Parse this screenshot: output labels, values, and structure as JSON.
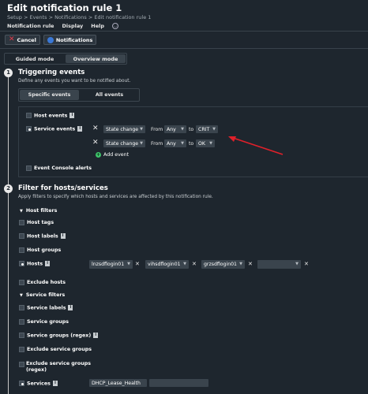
{
  "header": {
    "title": "Edit notification rule 1",
    "breadcrumb": "Setup > Events > Notifications > Edit notification rule 1"
  },
  "menu": {
    "items": [
      "Notification rule",
      "Display",
      "Help"
    ],
    "help_icon": "help-circle-icon"
  },
  "actions": {
    "cancel_label": "Cancel",
    "notifications_label": "Notifications"
  },
  "modes": {
    "guided": "Guided mode",
    "overview": "Overview mode",
    "selected": "Overview mode"
  },
  "step1": {
    "number": "1",
    "title": "Triggering events",
    "description": "Define any events you want to be notified about.",
    "tabs": [
      "Specific events",
      "All events"
    ],
    "selected_tab": "Specific events",
    "host_events": {
      "label": "Host events",
      "checked": false
    },
    "service_events": {
      "label": "Service events",
      "checked": true
    },
    "rules": [
      {
        "type": "State change",
        "from_label": "From",
        "from": "Any",
        "to_label": "to",
        "to": "CRIT"
      },
      {
        "type": "State change",
        "from_label": "From",
        "from": "Any",
        "to_label": "to",
        "to": "OK"
      }
    ],
    "add_event": "Add event",
    "event_console": {
      "label": "Event Console alerts",
      "checked": false
    }
  },
  "step2": {
    "number": "2",
    "title": "Filter for hosts/services",
    "description": "Apply filters to specify which hosts and services are affected by this notification rule.",
    "host_filters_label": "Host filters",
    "host_tags": "Host tags",
    "host_labels": "Host labels",
    "host_groups": "Host groups",
    "hosts": {
      "label": "Hosts",
      "checked": true,
      "values": [
        "lnzsdflogin01",
        "vihsdflogin01",
        "grzsdflogin01",
        ""
      ]
    },
    "exclude_hosts": "Exclude hosts",
    "service_filters_label": "Service filters",
    "service_labels": "Service labels",
    "service_groups": "Service groups",
    "service_groups_regex": "Service groups (regex)",
    "exclude_service_groups": "Exclude service groups",
    "exclude_service_groups_regex_1": "Exclude service groups",
    "exclude_service_groups_regex_2": "(regex)",
    "services": {
      "label": "Services",
      "checked": true,
      "value": "DHCP_Lease_Health",
      "value2": ""
    }
  },
  "colors": {
    "background": "#1e262e",
    "accent_red": "#e23c4b",
    "annotation_arrow": "#e0202a",
    "add_green": "#3fc56b"
  }
}
